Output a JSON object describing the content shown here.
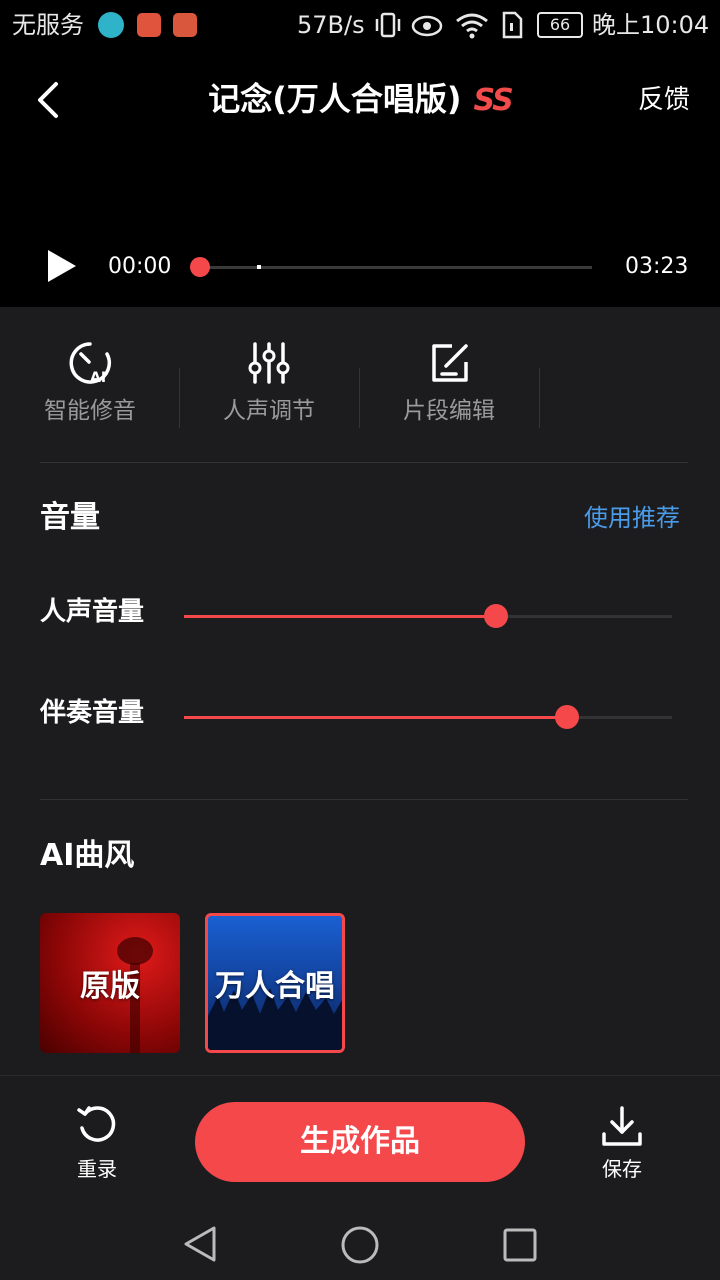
{
  "status_bar": {
    "carrier": "无服务",
    "net_speed": "57B/s",
    "battery": "66",
    "time": "晚上10:04"
  },
  "header": {
    "title": "记念(万人合唱版)",
    "badge": "SS",
    "feedback": "反馈"
  },
  "player": {
    "current_time": "00:00",
    "total_time": "03:23",
    "progress": 0.0
  },
  "tools": [
    {
      "label": "智能修音",
      "icon": "ai-tune-icon"
    },
    {
      "label": "人声调节",
      "icon": "equalizer-icon"
    },
    {
      "label": "片段编辑",
      "icon": "edit-icon"
    }
  ],
  "volume": {
    "title": "音量",
    "recommend": "使用推荐",
    "vocal_label": "人声音量",
    "vocal_level": 0.64,
    "accomp_label": "伴奏音量",
    "accomp_level": 0.785
  },
  "ai_style": {
    "title": "AI曲风",
    "cards": [
      {
        "label": "原版",
        "selected": false
      },
      {
        "label": "万人合唱",
        "selected": true
      }
    ]
  },
  "bottom": {
    "rerecord": "重录",
    "generate": "生成作品",
    "save": "保存"
  },
  "colors": {
    "accent": "#f5484b",
    "link": "#4a9be8"
  }
}
